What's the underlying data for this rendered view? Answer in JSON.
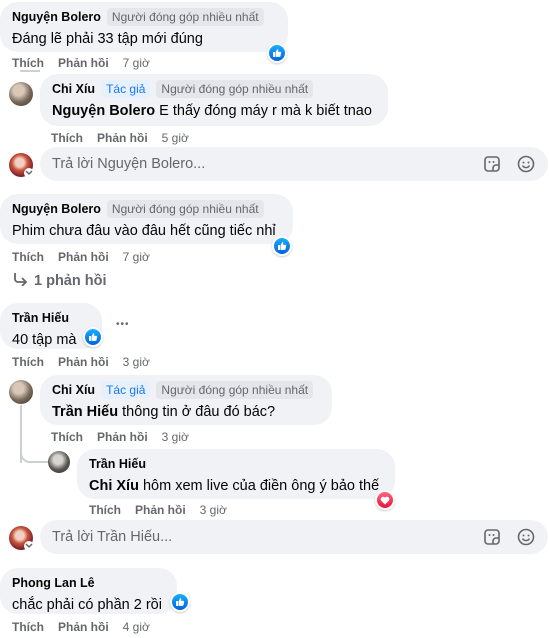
{
  "comments": [
    {
      "name": "Nguyện Bolero",
      "badge": "Người đóng góp nhiều nhất",
      "text": "Đáng lẽ phải 33 tập mới đúng",
      "like": "Thích",
      "reply": "Phản hồi",
      "time": "7 giờ",
      "reaction": "like"
    },
    {
      "name": "Chi Xíu",
      "author_badge": "Tác giả",
      "badge": "Người đóng góp nhiều nhất",
      "mention": "Nguyện Bolero",
      "text": "E thấy đóng máy r mà k biết tnao",
      "like": "Thích",
      "reply": "Phản hồi",
      "time": "5 giờ"
    },
    {
      "name": "Nguyện Bolero",
      "badge": "Người đóng góp nhiều nhất",
      "text": "Phim chưa đâu vào đâu hết cũng tiếc nhỉ",
      "like": "Thích",
      "reply": "Phản hồi",
      "time": "7 giờ",
      "reaction": "like",
      "replies_count": "1 phản hồi"
    },
    {
      "name": "Trần Hiếu",
      "text": "40 tập mà",
      "like": "Thích",
      "reply": "Phản hồi",
      "time": "3 giờ",
      "reaction": "like",
      "more": "•••"
    },
    {
      "name": "Chi Xíu",
      "author_badge": "Tác giả",
      "badge": "Người đóng góp nhiều nhất",
      "mention": "Trần Hiếu",
      "text": "thông tin ở đâu đó bác?",
      "like": "Thích",
      "reply": "Phản hồi",
      "time": "3 giờ"
    },
    {
      "name": "Trần Hiếu",
      "mention": "Chi Xíu",
      "text": "hôm xem live của điền ông ý bảo thế",
      "like": "Thích",
      "reply": "Phản hồi",
      "time": "3 giờ",
      "reaction": "love"
    },
    {
      "name": "Phong Lan Lê",
      "text": "chắc phải có phần 2 rồi",
      "like": "Thích",
      "reply": "Phản hồi",
      "time": "4 giờ",
      "reaction": "like"
    }
  ],
  "reply_boxes": [
    {
      "placeholder": "Trả lời Nguyện Bolero..."
    },
    {
      "placeholder": "Trả lời Trần Hiếu..."
    }
  ],
  "icons": {
    "sticker": "sticker-icon",
    "emoji": "emoji-icon",
    "like": "thumbs-up-icon",
    "love": "heart-icon",
    "reply_arrow": "reply-arrow-icon"
  },
  "colors": {
    "bubble": "#f0f2f5",
    "secondary_text": "#65676b",
    "like_blue": "#0866ff",
    "love_red": "#f02849",
    "author_blue": "#1877f2"
  }
}
